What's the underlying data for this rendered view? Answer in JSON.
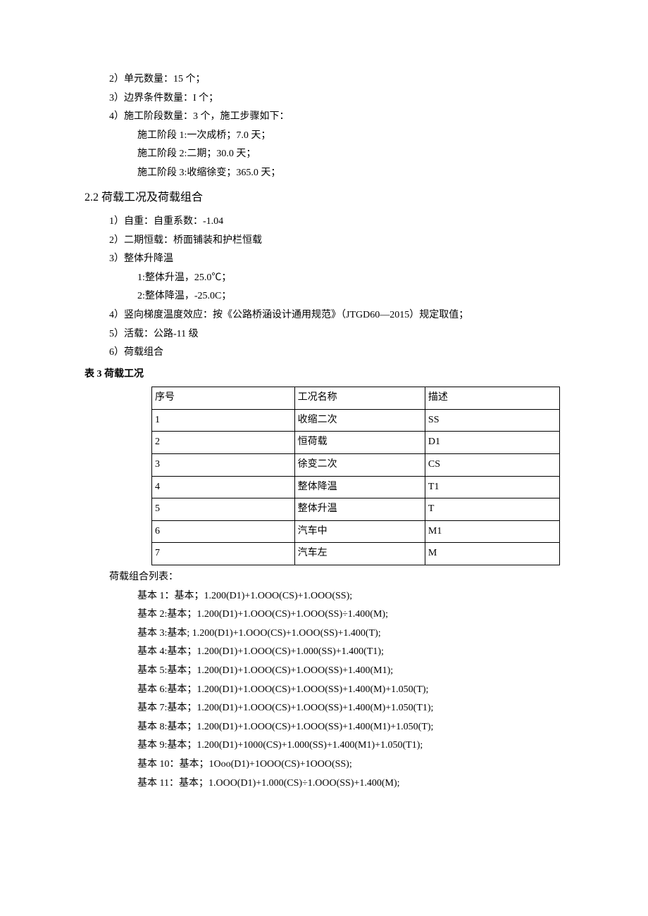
{
  "lines": {
    "l1": "2）单元数量：15 个；",
    "l2": "3）边界条件数量：I 个；",
    "l3": "4）施工阶段数量：3 个，施工步骤如下：",
    "l4": "施工阶段 1:一次成桥；7.0 天；",
    "l5": "施工阶段 2:二期；30.0 天；",
    "l6": "施工阶段 3:收缩徐变；365.0 天；"
  },
  "section_2_2": "2.2 荷载工况及荷载组合",
  "loads": {
    "p1": "1）自重：自重系数：-1.04",
    "p2": "2）二期恒载：桥面铺装和护栏恒载",
    "p3": "3）整体升降温",
    "p3a": "1:整体升温，25.0℃；",
    "p3b": "2:整体降温，-25.0C；",
    "p4": "4）竖向梯度温度效应：按《公路桥涵设计通用规范》（JTGD60—2015）规定取值；",
    "p5": "5）活载：公路-11 级",
    "p6": "6）荷载组合"
  },
  "table_title": "表 3 荷载工况",
  "table": {
    "h1": "序号",
    "h2": "工况名称",
    "h3": "描述",
    "r1c1": "1",
    "r1c2": "收缩二次",
    "r1c3": "SS",
    "r2c1": "2",
    "r2c2": "恒荷载",
    "r2c3": "D1",
    "r3c1": "3",
    "r3c2": "徐变二次",
    "r3c3": "CS",
    "r4c1": "4",
    "r4c2": "整体降温",
    "r4c3": "T1",
    "r5c1": "5",
    "r5c2": "整体升温",
    "r5c3": "T",
    "r6c1": "6",
    "r6c2": "汽车中",
    "r6c3": "M1",
    "r7c1": "7",
    "r7c2": "汽车左",
    "r7c3": "M"
  },
  "combo_label": "荷载组合列表：",
  "combos": {
    "c1": "基本 1：基本；1.200(D1)+1.OOO(CS)+1.OOO(SS);",
    "c2": "基本 2:基本；1.200(D1)+1.OOO(CS)+1.OOO(SS)÷1.400(M);",
    "c3": "基本 3:基本; 1.200(D1)+1.OOO(CS)+1.OOO(SS)+1.400(T);",
    "c4": "基本 4:基本；1.200(D1)+1.OOO(CS)+1.000(SS)+1.400(T1);",
    "c5": "基本 5:基本；1.200(D1)+1.OOO(CS)+1.OOO(SS)+1.400(M1);",
    "c6": "基本 6:基本；1.200(D1)+1.OOO(CS)+1.OOO(SS)+1.400(M)+1.050(T);",
    "c7": "基本 7:基本；1.200(D1)+1.OOO(CS)+1.OOO(SS)+1.400(M)+1.050(T1);",
    "c8": "基本 8:基本；1.200(D1)+1.OOO(CS)+1.OOO(SS)+1.400(M1)+1.050(T);",
    "c9": "基本 9:基本；1.200(D1)+1000(CS)+1.000(SS)+1.400(M1)+1.050(T1);",
    "c10": "基本 10：基本；1Ooo(D1)+1OOO(CS)+1OOO(SS);",
    "c11": "基本 11：基本；1.OOO(D1)+1.000(CS)÷1.OOO(SS)+1.400(M);"
  }
}
